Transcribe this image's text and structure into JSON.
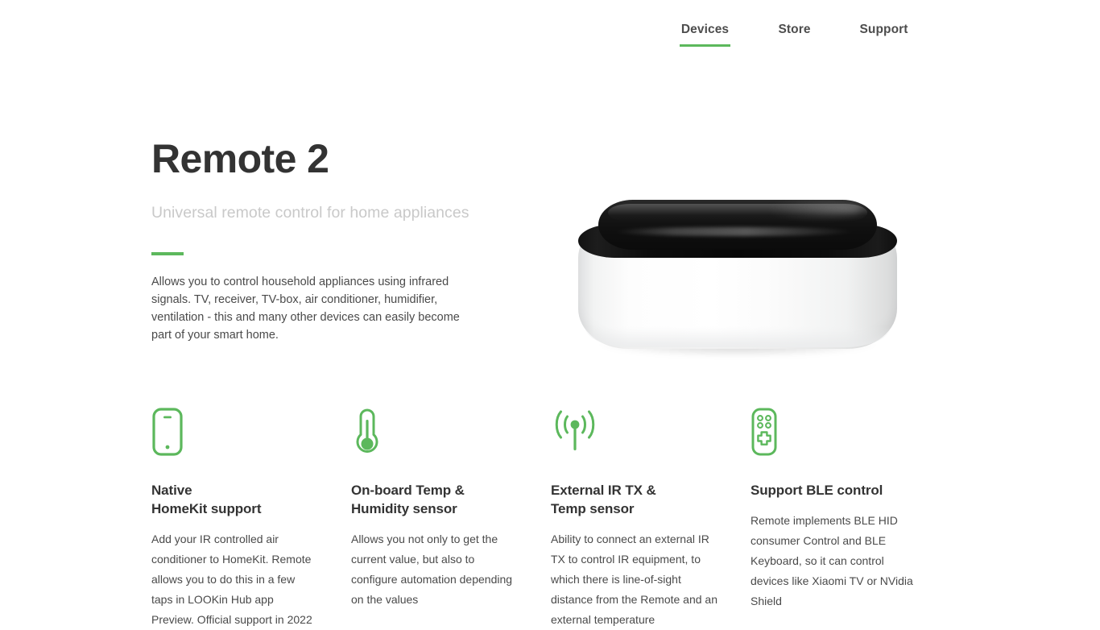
{
  "theme": {
    "accent_green": "#5cb85c",
    "title_color": "#333333",
    "subtitle_color": "#c9c9c9",
    "body_color": "#4a4a4a",
    "background": "#ffffff"
  },
  "nav": {
    "items": [
      {
        "label": "Devices",
        "active": true
      },
      {
        "label": "Store",
        "active": false
      },
      {
        "label": "Support",
        "active": false
      }
    ]
  },
  "hero": {
    "title": "Remote 2",
    "subtitle": "Universal remote control for home appliances",
    "description": "Allows you to control household appliances using infrared signals. TV, receiver, TV-box, air conditioner, humidifier, ventilation - this and many other devices can easily become part of your smart home.",
    "product_image_alt": "Remote 2 device"
  },
  "features": [
    {
      "icon": "smartphone-icon",
      "title_line1": "Native",
      "title_line2": "HomeKit support",
      "text": "Add your IR controlled air conditioner to HomeKit. Remote allows you to do this in a few taps in LOOKin Hub app Preview. Official support in 2022"
    },
    {
      "icon": "thermometer-icon",
      "title_line1": "On-board Temp &",
      "title_line2": "Humidity sensor",
      "text": "Allows you not only to get the current value, but also to configure automation depending on the values"
    },
    {
      "icon": "broadcast-signal-icon",
      "title_line1": "External IR TX &",
      "title_line2": "Temp sensor",
      "text": "Ability to connect an external IR TX to control IR equipment, to which there is line-of-sight distance from the Remote and an external temperature"
    },
    {
      "icon": "remote-control-icon",
      "title_line1": "Support BLE control",
      "title_line2": "",
      "text": "Remote implements BLE HID consumer Control and BLE Keyboard, so it can control devices like Xiaomi TV or NVidia Shield"
    }
  ]
}
